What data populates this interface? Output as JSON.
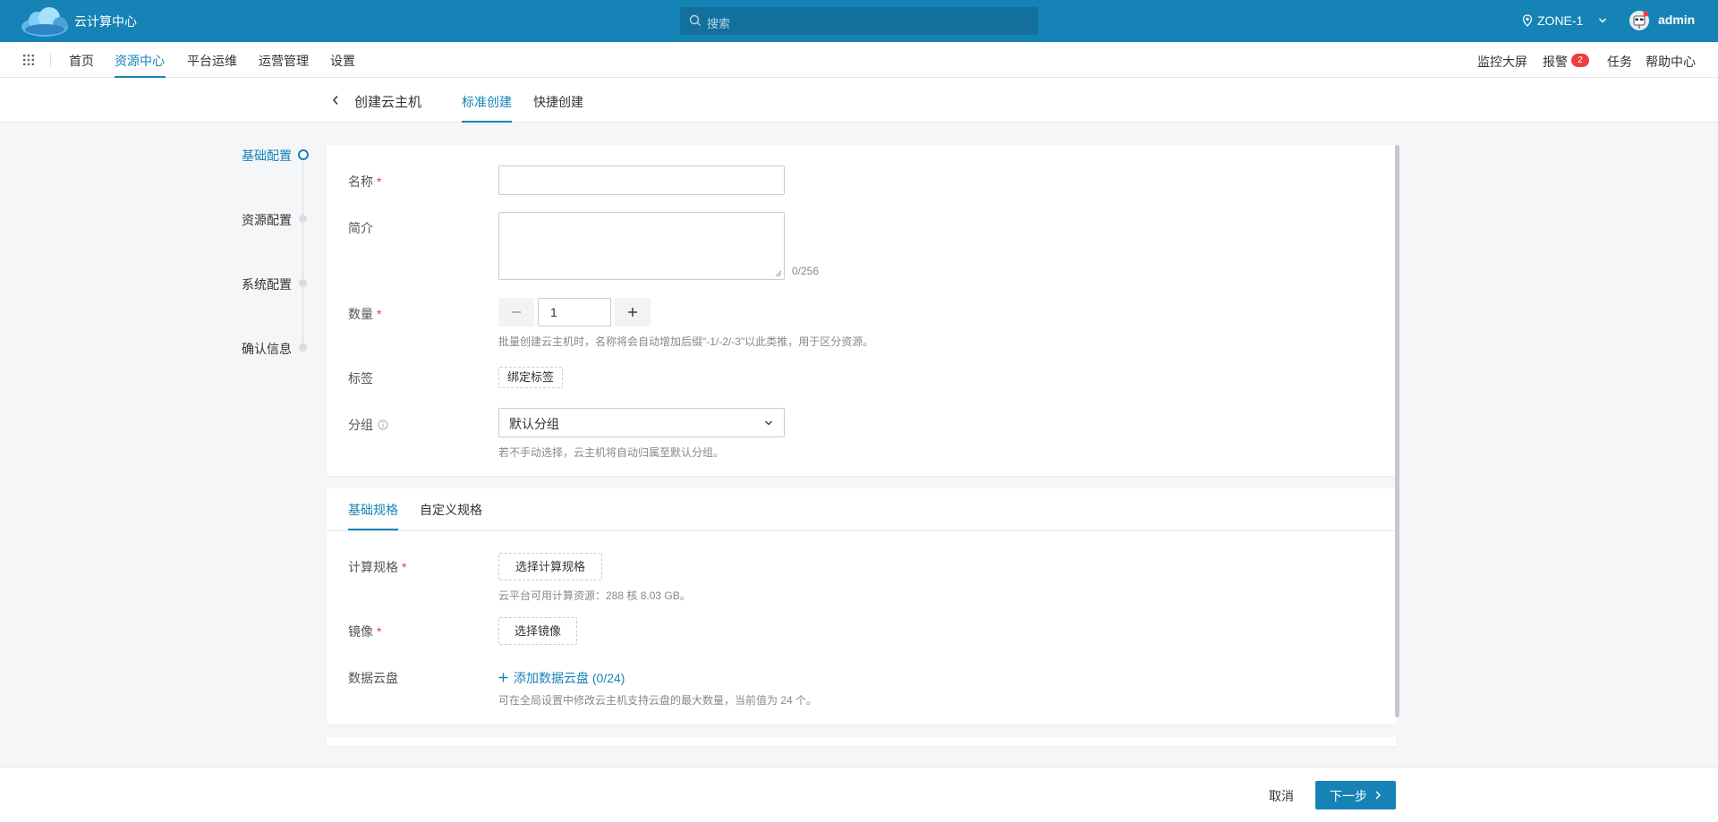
{
  "topbar": {
    "app_title": "云计算中心",
    "search_placeholder": "搜索",
    "zone": "ZONE-1",
    "user": "admin",
    "colors": {
      "bar": "#1683b6",
      "search": "#136f9b"
    }
  },
  "nav": {
    "items": [
      "首页",
      "资源中心",
      "平台运维",
      "运营管理",
      "设置"
    ],
    "active": "资源中心",
    "right": [
      "监控大屏",
      "报警",
      "任务",
      "帮助中心"
    ],
    "alarm_count": "2"
  },
  "subheader": {
    "title": "创建云主机",
    "tabs": [
      "标准创建",
      "快捷创建"
    ],
    "active_tab": "标准创建"
  },
  "steps": [
    "基础配置",
    "资源配置",
    "系统配置",
    "确认信息"
  ],
  "form": {
    "name_label": "名称",
    "desc_label": "简介",
    "desc_counter": "0/256",
    "qty_label": "数量",
    "qty_value": "1",
    "qty_hint": "批量创建云主机时，名称将会自动增加后缀\"-1/-2/-3\"以此类推，用于区分资源。",
    "tag_label": "标签",
    "tag_button": "绑定标签",
    "group_label": "分组",
    "group_value": "默认分组",
    "group_hint": "若不手动选择，云主机将自动归属至默认分组。",
    "required_mark": "*"
  },
  "spec": {
    "tabs": [
      "基础规格",
      "自定义规格"
    ],
    "active_tab": "基础规格",
    "compute_label": "计算规格",
    "compute_button": "选择计算规格",
    "compute_hint": "云平台可用计算资源：288 核 8.03 GB。",
    "image_label": "镜像",
    "image_button": "选择镜像",
    "disk_label": "数据云盘",
    "disk_add": "添加数据云盘 (0/24)",
    "disk_hint": "可在全局设置中修改云主机支持云盘的最大数量，当前值为 24 个。"
  },
  "footer": {
    "cancel": "取消",
    "next": "下一步"
  }
}
